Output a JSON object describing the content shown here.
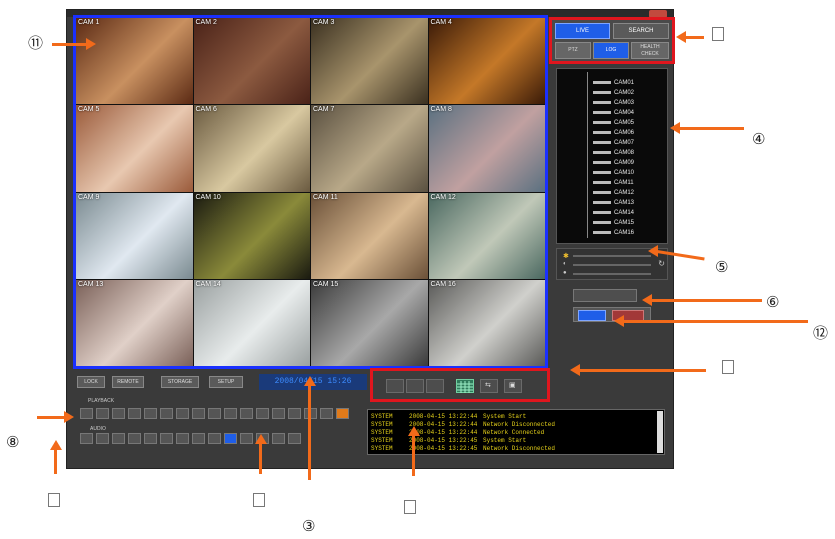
{
  "cameras": [
    "CAM 1",
    "CAM 2",
    "CAM 3",
    "CAM 4",
    "CAM 5",
    "CAM 6",
    "CAM 7",
    "CAM 8",
    "CAM 9",
    "CAM 10",
    "CAM 11",
    "CAM 12",
    "CAM 13",
    "CAM 14",
    "CAM 15",
    "CAM 16"
  ],
  "camera_tile_colors": [
    [
      "#5b2a14",
      "#c89060"
    ],
    [
      "#4a2218",
      "#8c5a40"
    ],
    [
      "#3a3020",
      "#a8946c"
    ],
    [
      "#3a1a08",
      "#c47828"
    ],
    [
      "#9a5a3a",
      "#e8c8b0"
    ],
    [
      "#6a5a40",
      "#d8c8a0"
    ],
    [
      "#5a5040",
      "#b8a888"
    ],
    [
      "#5a7080",
      "#c0a0a0"
    ],
    [
      "#7a8a90",
      "#e0e8f0"
    ],
    [
      "#1a1a10",
      "#8a8a3a"
    ],
    [
      "#6a5038",
      "#d8b890"
    ],
    [
      "#4a6860",
      "#c0c8b8"
    ],
    [
      "#7a6058",
      "#e0d0c8"
    ],
    [
      "#9aa0a0",
      "#e8ecec"
    ],
    [
      "#3a3a3a",
      "#a8a8a8"
    ],
    [
      "#5a5a58",
      "#d0d0cc"
    ]
  ],
  "mode_tabs": {
    "live": "LIVE",
    "search": "SEARCH"
  },
  "sub_tabs": [
    "PTZ",
    "LOG",
    "HEALTH CHECK"
  ],
  "camera_tree": [
    "CAM01",
    "CAM02",
    "CAM03",
    "CAM04",
    "CAM05",
    "CAM06",
    "CAM07",
    "CAM08",
    "CAM09",
    "CAM10",
    "CAM11",
    "CAM12",
    "CAM13",
    "CAM14",
    "CAM15",
    "CAM16"
  ],
  "toolbar": {
    "btn1": "LOCK",
    "btn2": "REMOTE",
    "btn3": "STORAGE",
    "btn4": "SETUP",
    "clock": "2008/04/15 15:26"
  },
  "playback": {
    "label1": "PLAYBACK",
    "label2": "AUDIO"
  },
  "log": [
    [
      "SYSTEM",
      "2008-04-15 13:22:44",
      "System Start"
    ],
    [
      "SYSTEM",
      "2008-04-15 13:22:44",
      "Network Disconnected"
    ],
    [
      "SYSTEM",
      "2008-04-15 13:22:44",
      "Network Connected"
    ],
    [
      "SYSTEM",
      "2008-04-15 13:22:45",
      "System Start"
    ],
    [
      "SYSTEM",
      "2008-04-15 13:22:45",
      "Network Disconnected"
    ]
  ],
  "callouts": {
    "c11": "⑪",
    "c4": "④",
    "c5": "⑤",
    "c6": "⑥",
    "c12": "⑫",
    "c8": "⑧",
    "c3": "③"
  },
  "accent_colors": {
    "grid_border": "#1a30ff",
    "highlight_box": "#e0161e",
    "arrow": "#f26a1a"
  }
}
